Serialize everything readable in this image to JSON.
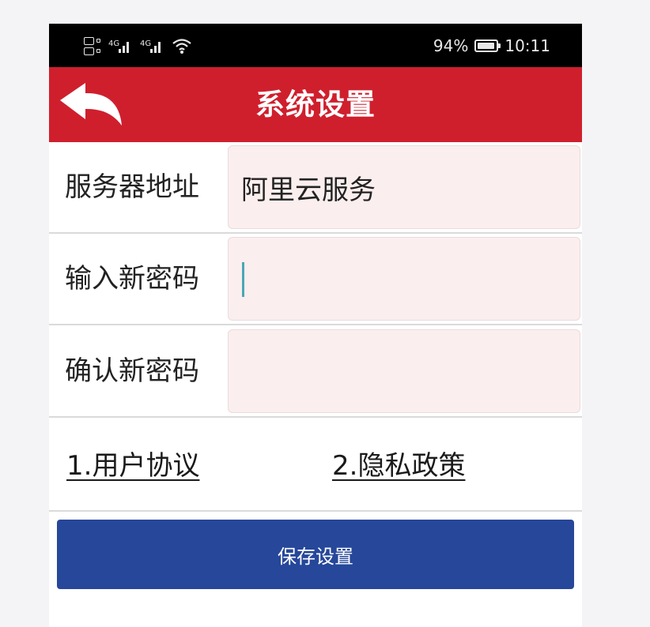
{
  "status_bar": {
    "battery": "94%",
    "battery_level": 0.94,
    "time": "10:11",
    "icons": [
      "hd-icon",
      "signal-icon",
      "signal-icon",
      "wifi-icon",
      "battery-icon"
    ]
  },
  "header": {
    "title": "系统设置",
    "back_icon": "back-arrow-icon",
    "background": "#cf1f2d"
  },
  "form": {
    "server": {
      "label": "服务器地址",
      "value": "阿里云服务"
    },
    "new_password": {
      "label": "输入新密码",
      "value": ""
    },
    "confirm_password": {
      "label": "确认新密码",
      "value": ""
    }
  },
  "links": {
    "user_agreement": "1.用户协议",
    "privacy_policy": "2.隐私政策"
  },
  "save_button": {
    "label": "保存设置",
    "background": "#26479a"
  }
}
